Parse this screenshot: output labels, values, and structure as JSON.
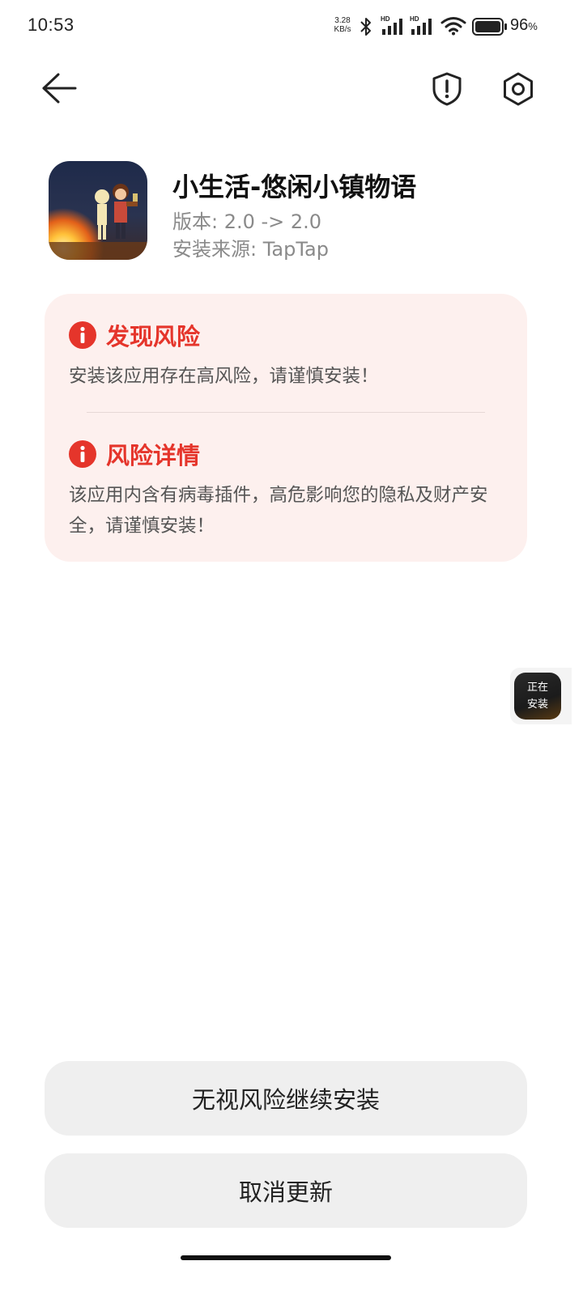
{
  "status_bar": {
    "time": "10:53",
    "net_speed_value": "3.28",
    "net_speed_unit": "KB/s",
    "signal_label_1": "HD",
    "signal_label_2": "HD",
    "battery_percent": "96",
    "battery_unit": "%"
  },
  "nav": {
    "back_icon": "arrow-left-icon",
    "shield_icon": "shield-exclamation-icon",
    "settings_icon": "gear-icon"
  },
  "app": {
    "name": "小生活-悠闲小镇物语",
    "version": "版本: 2.0 -> 2.0",
    "source": "安装来源: TapTap"
  },
  "risk": {
    "found_title": "发现风险",
    "found_desc": "安装该应用存在高风险，请谨慎安装！",
    "detail_title": "风险详情",
    "detail_desc": "该应用内含有病毒插件，高危影响您的隐私及财产安全，请谨慎安装！"
  },
  "floating_badge": {
    "line1": "正在",
    "line2": "安装"
  },
  "buttons": {
    "continue_label": "无视风险继续安装",
    "cancel_label": "取消更新"
  },
  "colors": {
    "risk_accent": "#e5352b",
    "risk_card_bg": "#fdf0ee",
    "button_bg": "#efefef"
  }
}
